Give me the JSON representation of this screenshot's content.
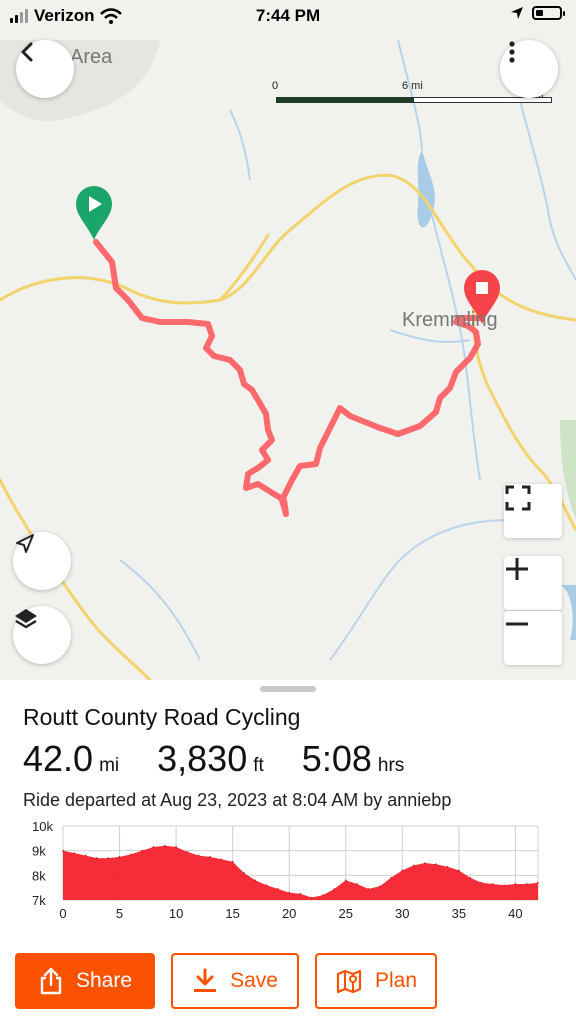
{
  "status_bar": {
    "carrier": "Verizon",
    "time": "7:44 PM",
    "battery_level": 0.3
  },
  "map": {
    "labels": {
      "area_label": "Area",
      "town_label": "Kremmling"
    },
    "scale_bar": {
      "ticks": [
        "0",
        "6 mi",
        "12 mi"
      ],
      "filled_fraction": 0.5
    },
    "colors": {
      "route": "#ff5a5f",
      "start_marker": "#1aa56b",
      "end_marker": "#f5434a",
      "road": "#f3d36b",
      "water": "#a8cbe8",
      "land": "#f1f1ee",
      "stream": "#b9d4ea"
    },
    "icons": {
      "back": "chevron-left-icon",
      "more": "vertical-ellipsis-icon",
      "locate": "navigation-arrow-icon",
      "layers": "layers-icon",
      "fullscreen": "fullscreen-icon",
      "zoom_in": "plus-icon",
      "zoom_out": "minus-icon"
    }
  },
  "activity": {
    "title": "Routt County Road Cycling",
    "distance": {
      "value": "42.0",
      "unit": "mi"
    },
    "elevation": {
      "value": "3,830",
      "unit": "ft"
    },
    "time": {
      "value": "5:08",
      "unit": "hrs"
    },
    "meta": "Ride departed at Aug 23, 2023 at 8:04 AM by anniebp"
  },
  "chart_data": {
    "type": "area",
    "title": "",
    "xlabel": "",
    "ylabel": "",
    "x_ticks": [
      "0",
      "5",
      "10",
      "15",
      "20",
      "25",
      "30",
      "35",
      "40"
    ],
    "y_ticks": [
      "7k",
      "8k",
      "9k",
      "10k"
    ],
    "xlim": [
      0,
      42
    ],
    "ylim": [
      7000,
      10000
    ],
    "grid": true,
    "color": "#f5222d",
    "x": [
      0,
      1,
      2,
      3,
      4,
      5,
      6,
      7,
      8,
      9,
      10,
      11,
      12,
      13,
      14,
      15,
      16,
      17,
      18,
      19,
      20,
      21,
      22,
      23,
      24,
      25,
      26,
      27,
      28,
      29,
      30,
      31,
      32,
      33,
      34,
      35,
      36,
      37,
      38,
      39,
      40,
      41,
      42
    ],
    "values": [
      9000,
      8900,
      8800,
      8700,
      8700,
      8750,
      8850,
      9000,
      9150,
      9200,
      9150,
      8950,
      8800,
      8750,
      8650,
      8550,
      8100,
      7800,
      7600,
      7450,
      7300,
      7250,
      7100,
      7200,
      7450,
      7800,
      7650,
      7450,
      7550,
      7900,
      8200,
      8400,
      8500,
      8450,
      8350,
      8200,
      7900,
      7700,
      7650,
      7600,
      7650,
      7650,
      7700
    ]
  },
  "actions": {
    "share": {
      "label": "Share",
      "icon": "share-icon"
    },
    "save": {
      "label": "Save",
      "icon": "download-icon"
    },
    "plan": {
      "label": "Plan",
      "icon": "map-pin-icon"
    }
  }
}
